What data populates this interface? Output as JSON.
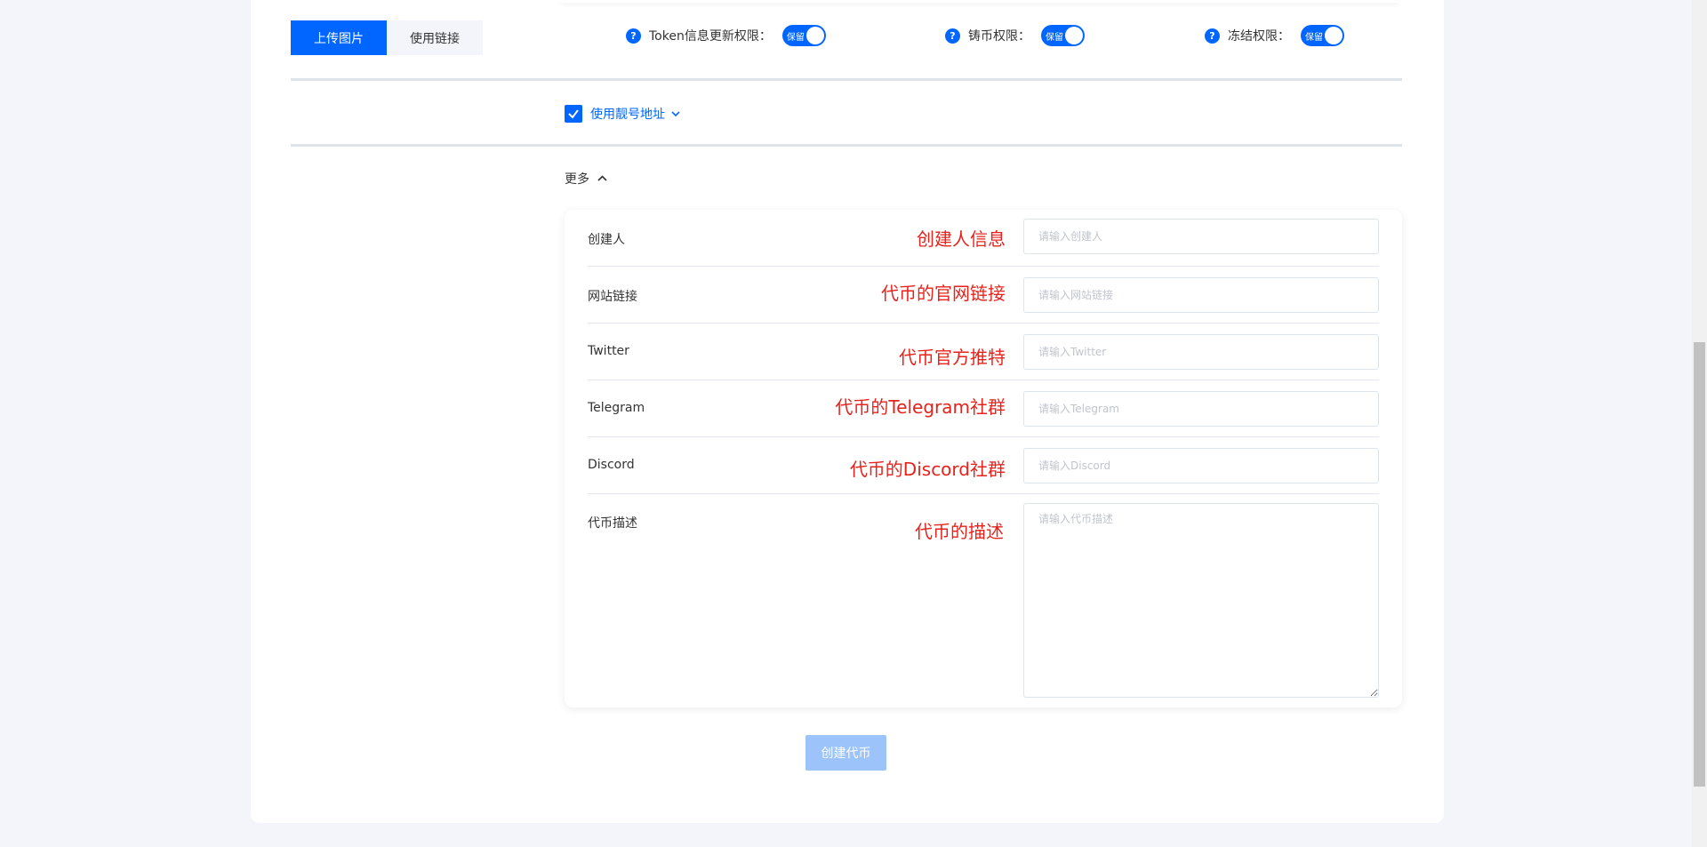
{
  "image_source": {
    "upload_label": "上传图片",
    "link_label": "使用链接"
  },
  "permissions": [
    {
      "label": "Token信息更新权限：",
      "toggle": "保留",
      "icon": "help-icon"
    },
    {
      "label": "铸币权限：",
      "toggle": "保留",
      "icon": "help-icon"
    },
    {
      "label": "冻结权限：",
      "toggle": "保留",
      "icon": "help-icon"
    }
  ],
  "vanity": {
    "label": "使用靓号地址",
    "checked": true
  },
  "more": {
    "label": "更多"
  },
  "form": {
    "rows": [
      {
        "label": "创建人",
        "annotation": "创建人信息",
        "placeholder": "请输入创建人"
      },
      {
        "label": "网站链接",
        "annotation": "代币的官网链接",
        "placeholder": "请输入网站链接"
      },
      {
        "label": "Twitter",
        "annotation": "代币官方推特",
        "placeholder": "请输入Twitter"
      },
      {
        "label": "Telegram",
        "annotation": "代币的Telegram社群",
        "placeholder": "请输入Telegram"
      },
      {
        "label": "Discord",
        "annotation": "代币的Discord社群",
        "placeholder": "请输入Discord"
      },
      {
        "label": "代币描述",
        "annotation": "代币的描述",
        "placeholder": "请输入代币描述"
      }
    ]
  },
  "submit_label": "创建代币",
  "colors": {
    "primary": "#0066ff",
    "annotation": "#e5231c",
    "submit_disabled": "#9cc4fb"
  }
}
